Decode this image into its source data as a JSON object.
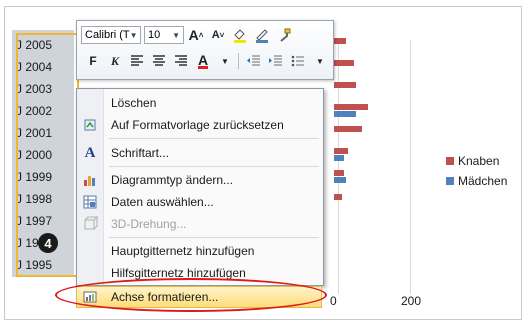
{
  "axis": {
    "years": [
      "J 2005",
      "J 2004",
      "J 2003",
      "J 2002",
      "J 2001",
      "J 2000",
      "J 1999",
      "J 1998",
      "J 1997",
      "J 1996",
      "J 1995"
    ]
  },
  "x_axis": {
    "ticks": [
      "0",
      "200"
    ]
  },
  "legend": [
    {
      "label": "Knaben",
      "color": "#c0504d"
    },
    {
      "label": "Mädchen",
      "color": "#4f81bd"
    }
  ],
  "marker": {
    "number": "4"
  },
  "mini_toolbar": {
    "font_name": "Calibri (T",
    "font_size": "10",
    "bold_label": "F",
    "italic_label": "K"
  },
  "context_menu": {
    "items": [
      {
        "label": "Löschen",
        "icon": "none",
        "disabled": false
      },
      {
        "label": "Auf Formatvorlage zurücksetzen",
        "icon": "reset-style-icon",
        "disabled": false
      },
      {
        "label": "Schriftart...",
        "icon": "font-icon",
        "disabled": false
      },
      {
        "label": "Diagrammtyp ändern...",
        "icon": "chart-type-icon",
        "disabled": false
      },
      {
        "label": "Daten auswählen...",
        "icon": "select-data-icon",
        "disabled": false
      },
      {
        "label": "3D-Drehung...",
        "icon": "3d-rotation-icon",
        "disabled": true
      },
      {
        "label": "Hauptgitternetz hinzufügen",
        "icon": "none",
        "disabled": false
      },
      {
        "label": "Hilfsgitternetz hinzufügen",
        "icon": "none",
        "disabled": false
      },
      {
        "label": "Achse formatieren...",
        "icon": "format-axis-icon",
        "disabled": false,
        "highlighted": true
      }
    ]
  },
  "colors": {
    "knaben": "#c0504d",
    "maedchen": "#4f81bd",
    "selection": "#f2b632",
    "annotation": "#e01818"
  }
}
